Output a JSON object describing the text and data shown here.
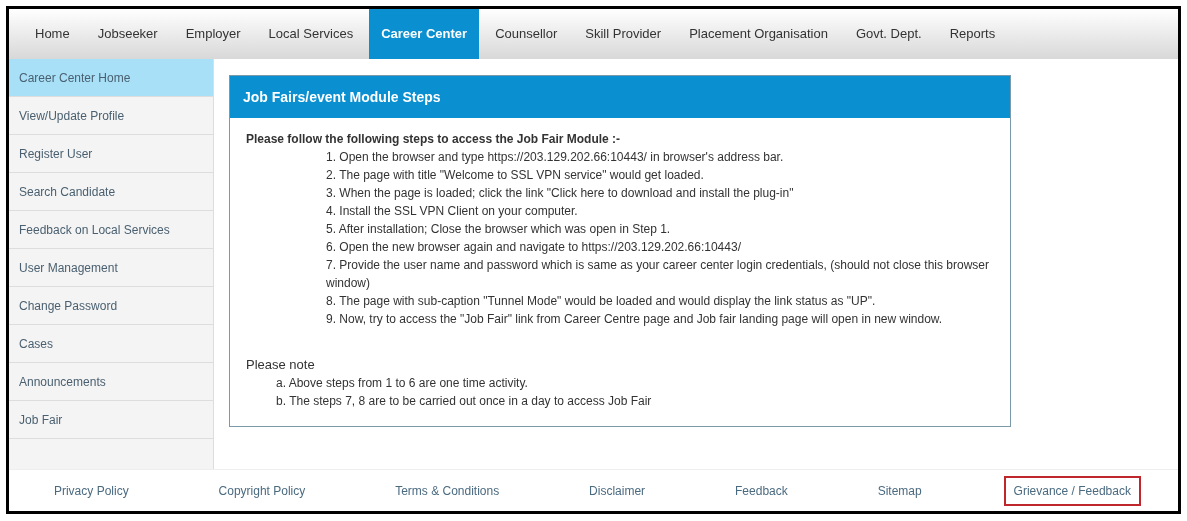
{
  "nav": [
    {
      "label": "Home",
      "selected": false
    },
    {
      "label": "Jobseeker",
      "selected": false
    },
    {
      "label": "Employer",
      "selected": false
    },
    {
      "label": "Local Services",
      "selected": false
    },
    {
      "label": "Career Center",
      "selected": true
    },
    {
      "label": "Counsellor",
      "selected": false
    },
    {
      "label": "Skill Provider",
      "selected": false
    },
    {
      "label": "Placement Organisation",
      "selected": false
    },
    {
      "label": "Govt. Dept.",
      "selected": false
    },
    {
      "label": "Reports",
      "selected": false
    }
  ],
  "sidebar": {
    "items": [
      {
        "label": "Career Center Home",
        "selected": true
      },
      {
        "label": "View/Update Profile",
        "selected": false
      },
      {
        "label": "Register User",
        "selected": false
      },
      {
        "label": "Search Candidate",
        "selected": false
      },
      {
        "label": "Feedback on Local Services",
        "selected": false
      },
      {
        "label": "User Management",
        "selected": false
      },
      {
        "label": "Change Password",
        "selected": false
      },
      {
        "label": "Cases",
        "selected": false
      },
      {
        "label": "Announcements",
        "selected": false
      },
      {
        "label": "Job Fair",
        "selected": false
      }
    ]
  },
  "panel": {
    "title": "Job Fairs/event Module Steps",
    "intro": "Please follow the following steps to access the Job Fair Module :-",
    "steps": [
      "1. Open the browser and type https://203.129.202.66:10443/ in browser's address bar.",
      "2. The page with title \"Welcome to SSL VPN service\" would get loaded.",
      "3. When the page is loaded; click the link \"Click here to download and install the plug-in\"",
      "4. Install the SSL VPN Client on your computer.",
      "5. After installation; Close the browser which was open in Step 1.",
      "6. Open the new browser again and navigate to https://203.129.202.66:10443/",
      "7. Provide the user name and password which is same as your career center login credentials, (should not close this browser window)",
      "8. The page with sub-caption \"Tunnel Mode\" would be loaded and would display the link status as \"UP\".",
      "9. Now, try to access the \"Job Fair\" link from Career Centre page and Job fair landing page will open in new window."
    ],
    "note_title": "Please note",
    "notes": [
      "a. Above steps from 1 to 6 are one time activity.",
      "b. The steps 7, 8 are to be carried out once in a day to access Job Fair"
    ]
  },
  "footer": [
    {
      "label": "Privacy Policy",
      "highlighted": false
    },
    {
      "label": "Copyright Policy",
      "highlighted": false
    },
    {
      "label": "Terms & Conditions",
      "highlighted": false
    },
    {
      "label": "Disclaimer",
      "highlighted": false
    },
    {
      "label": "Feedback",
      "highlighted": false
    },
    {
      "label": "Sitemap",
      "highlighted": false
    },
    {
      "label": "Grievance / Feedback",
      "highlighted": true
    }
  ]
}
